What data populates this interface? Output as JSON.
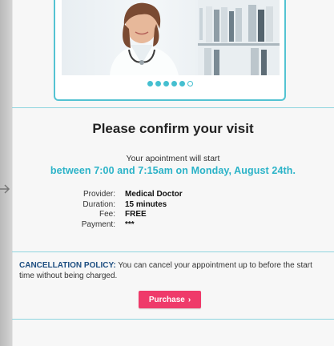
{
  "carousel": {
    "slide_count": 6,
    "active_slides": 5
  },
  "confirm": {
    "title": "Please confirm your visit",
    "subtitle": "Your apointment will start",
    "time_line": "between 7:00 and 7:15am on Monday, August 24th."
  },
  "details": [
    {
      "label": "Provider:",
      "value": "Medical Doctor"
    },
    {
      "label": "Duration:",
      "value": "15 minutes"
    },
    {
      "label": "Fee:",
      "value": "FREE"
    },
    {
      "label": "Payment:",
      "value": "***"
    }
  ],
  "policy": {
    "title": "CANCELLATION POLICY:",
    "text": " You can cancel your appointment up to before the start time without being charged."
  },
  "actions": {
    "purchase_label": "Purchase",
    "purchase_chevron": "›"
  },
  "colors": {
    "accent": "#2bb3c8",
    "button": "#ef3a6a",
    "policy_title": "#1c4d80"
  },
  "icons": {
    "left_arrow": "arrow-right-icon",
    "hero": "doctor-photo"
  }
}
